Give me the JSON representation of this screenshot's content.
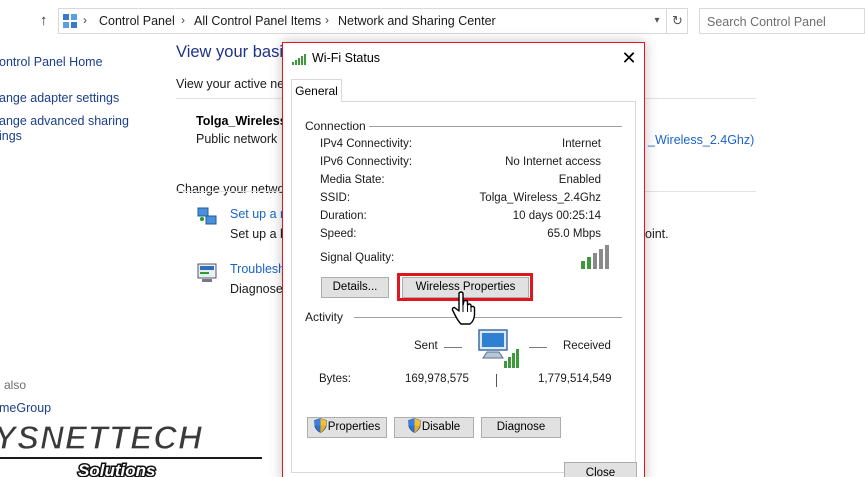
{
  "address_bar": {
    "crumbs": [
      "Control Panel",
      "All Control Panel Items",
      "Network and Sharing Center"
    ],
    "search_placeholder": "Search Control Panel"
  },
  "left_nav": {
    "home": "ontrol Panel Home",
    "change_adapter": "ange adapter settings",
    "change_advanced_1": "ange advanced sharing",
    "change_advanced_2": "ings",
    "see_also": "also",
    "homegroup": "meGroup"
  },
  "main": {
    "title": "View your basic",
    "active_networks": "View your active net",
    "network_name": "Tolga_Wireless_",
    "network_type": "Public network",
    "connection_link": "_Wireless_2.4Ghz)",
    "change_settings": "Change your networ",
    "setup_link": "Set up a n",
    "setup_desc": "Set up a b",
    "setup_desc_tail": "oint.",
    "troubleshoot_link": "Troublesh",
    "troubleshoot_desc": "Diagnose"
  },
  "watermark": {
    "brand": "YSNETTECH",
    "sub": "Solutions"
  },
  "dialog": {
    "title": "Wi-Fi Status",
    "tab": "General",
    "connection_group": "Connection",
    "rows": [
      {
        "label": "IPv4 Connectivity:",
        "value": "Internet"
      },
      {
        "label": "IPv6 Connectivity:",
        "value": "No Internet access"
      },
      {
        "label": "Media State:",
        "value": "Enabled"
      },
      {
        "label": "SSID:",
        "value": "Tolga_Wireless_2.4Ghz"
      },
      {
        "label": "Duration:",
        "value": "10 days 00:25:14"
      },
      {
        "label": "Speed:",
        "value": "65.0 Mbps"
      }
    ],
    "signal_label": "Signal Quality:",
    "signal_bars": 5,
    "details_button": "Details...",
    "wireless_button": "Wireless Properties",
    "activity_group": "Activity",
    "sent_label": "Sent",
    "received_label": "Received",
    "bytes_label": "Bytes:",
    "bytes_sent": "169,978,575",
    "bytes_received": "1,779,514,549",
    "properties_button": "Properties",
    "disable_button": "Disable",
    "diagnose_button": "Diagnose",
    "close_button": "Close"
  },
  "colors": {
    "accent_red": "#e0151f",
    "link_blue": "#1a64c8",
    "signal_green": "#3c9a3c"
  }
}
